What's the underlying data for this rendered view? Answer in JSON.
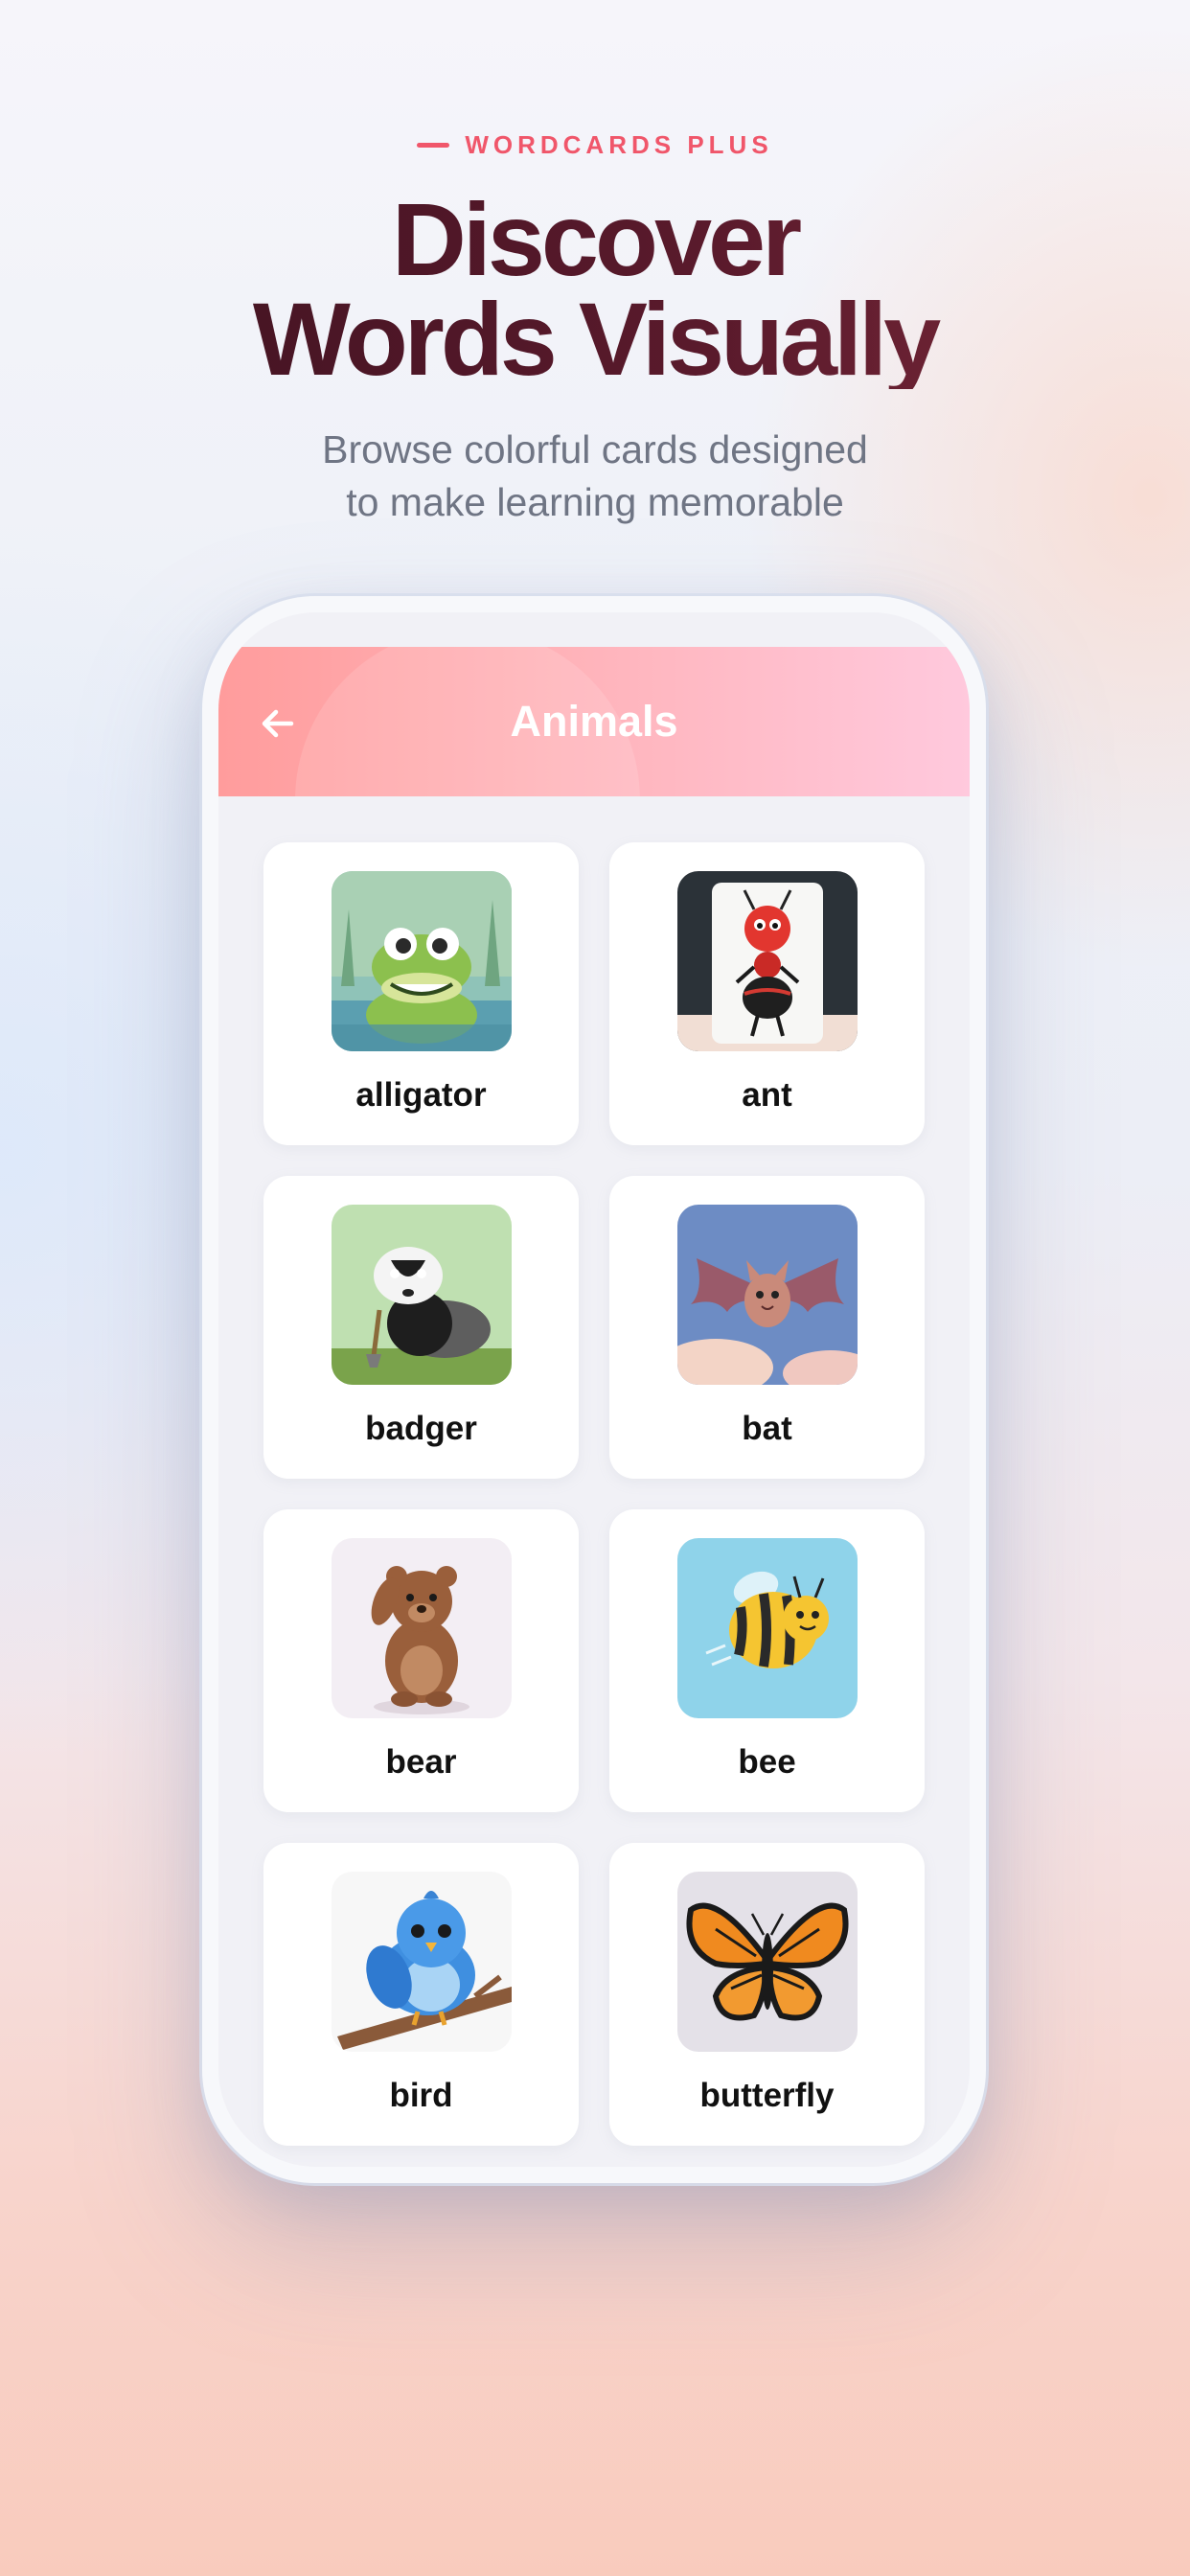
{
  "brand": "WORDCARDS PLUS",
  "headline": {
    "line1": "Discover",
    "line2": "Words Visually"
  },
  "subtitle": {
    "line1": "Browse colorful cards designed",
    "line2": "to make learning memorable"
  },
  "app": {
    "back_icon": "arrow-left-icon",
    "title": "Animals",
    "cards": [
      {
        "word": "alligator"
      },
      {
        "word": "ant"
      },
      {
        "word": "badger"
      },
      {
        "word": "bat"
      },
      {
        "word": "bear"
      },
      {
        "word": "bee"
      },
      {
        "word": "bird"
      },
      {
        "word": "butterfly"
      }
    ]
  },
  "colors": {
    "accent": "#f0566a",
    "headline": "#4a1624",
    "nav_start": "#ff9c9c",
    "nav_end": "#ffc9dd"
  }
}
